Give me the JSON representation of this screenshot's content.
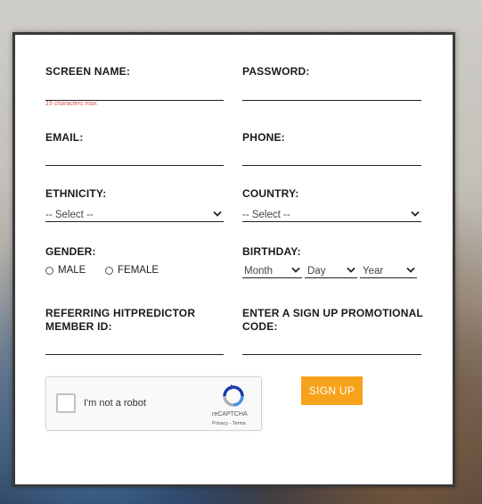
{
  "form": {
    "screen_name_label": "SCREEN NAME:",
    "screen_name_hint": "15 characters max.",
    "password_label": "PASSWORD:",
    "email_label": "EMAIL:",
    "phone_label": "PHONE:",
    "ethnicity_label": "ETHNICITY:",
    "ethnicity_value": "-- Select --",
    "country_label": "COUNTRY:",
    "country_value": "-- Select --",
    "gender_label": "GENDER:",
    "gender_male": "MALE",
    "gender_female": "FEMALE",
    "birthday_label": "BIRTHDAY:",
    "birthday_month": "Month",
    "birthday_day": "Day",
    "birthday_year": "Year",
    "referring_label_line1": "REFERRING HITPREDICTOR",
    "referring_label_line2": "MEMBER ID:",
    "promo_label_line1": "ENTER A SIGN UP PROMOTIONAL",
    "promo_label_line2": "CODE:",
    "signup_button": "SIGN UP"
  },
  "captcha": {
    "checkbox_text": "I'm not a robot",
    "brand": "reCAPTCHA",
    "links": "Privacy - Terms"
  },
  "colors": {
    "accent": "#f7a21b",
    "hint": "#d9534f"
  }
}
